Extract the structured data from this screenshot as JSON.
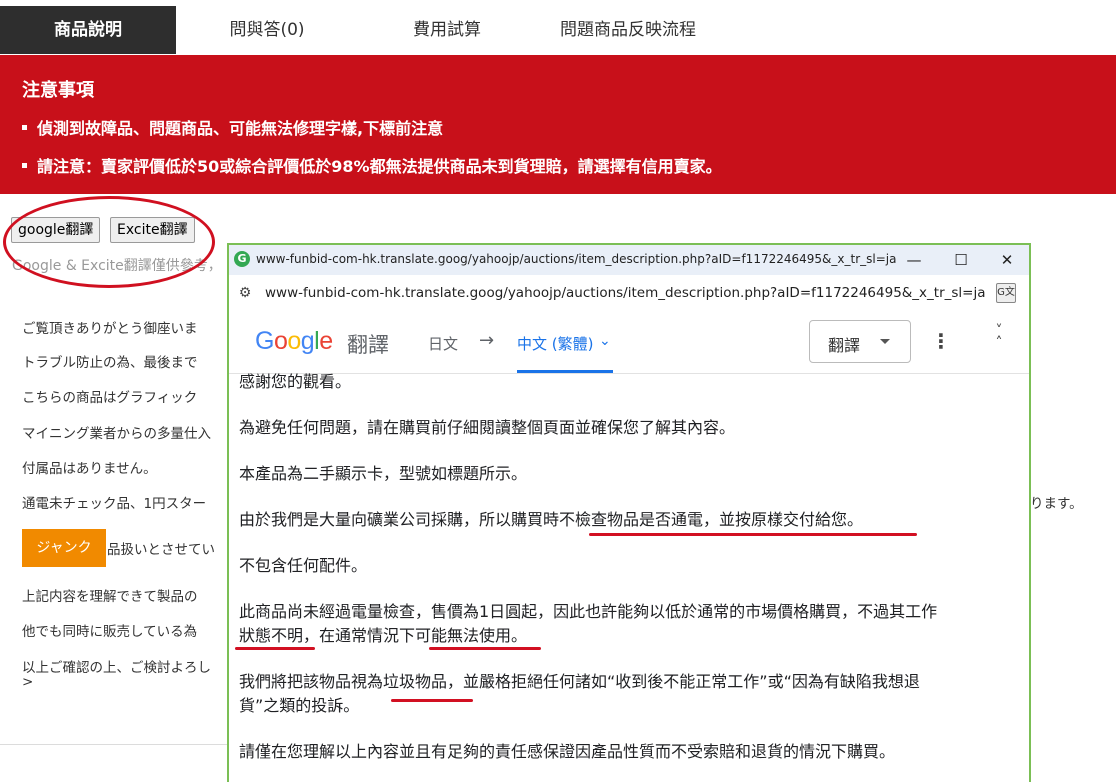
{
  "tabs": [
    {
      "label": "商品說明",
      "active": true
    },
    {
      "label": "問與答(0)",
      "active": false
    },
    {
      "label": "費用試算",
      "active": false
    },
    {
      "label": "問題商品反映流程",
      "active": false
    }
  ],
  "notice": {
    "title": "注意事項",
    "items": [
      "偵測到故障品、問題商品、可能無法修理字樣,下標前注意",
      "請注意：賣家評價低於50或綜合評價低於98%都無法提供商品未到貨理賠，請選擇有信用賣家。"
    ]
  },
  "translate_buttons": {
    "google": "google翻譯",
    "excite": "Excite翻譯"
  },
  "translate_note": "Google & Excite翻譯僅供參考，",
  "background_lines": [
    "ご覧頂きありがとう御座いま",
    "トラブル防止の為、最後まで",
    "こちらの商品はグラフィック",
    "マイニング業者からの多量仕入",
    "付属品はありません。",
    "通電未チェック品、1円スター",
    "品扱いとさせてい",
    "上記内容を理解できて製品の",
    "他でも同時に販売している為",
    "以上ご確認の上、ご検討よろし",
    ">"
  ],
  "background_right_text": "ります。",
  "junk_badge": "ジャンク",
  "popup": {
    "window_title": "www-funbid-com-hk.translate.goog/yahoojp/auctions/item_description.php?aID=f1172246495&_x_tr_sl=ja&_x_tr_tl=z...",
    "url": "www-funbid-com-hk.translate.goog/yahoojp/auctions/item_description.php?aID=f1172246495&_x_tr_sl=ja&_x_tr_...",
    "google_logo": "Google",
    "product_name": "翻譯",
    "source_lang": "日文",
    "arrow": "→",
    "target_lang": "中文 (繁體)",
    "translate_button": "翻譯",
    "translated_lines": [
      "感謝您的觀看。",
      "為避免任何問題，請在購買前仔細閱讀整個頁面並確保您了解其內容。",
      "本產品為二手顯示卡，型號如標題所示。",
      "由於我們是大量向礦業公司採購，所以購買時不檢查物品是否通電，並按原樣交付給您。",
      "不包含任何配件。",
      "此商品尚未經過電量檢查，售價為1日圓起，因此也許能夠以低於通常的市場價格購買，不過其工作",
      "狀態不明，在通常情況下可能無法使用。",
      "我們將把該物品視為垃圾物品，並嚴格拒絕任何諸如“收到後不能正常工作”或“因為有缺陷我想退",
      "貨”之類的投訴。",
      "請僅在您理解以上內容並且有足夠的責任感保證因產品性質而不受索賠和退貨的情況下購買。"
    ]
  },
  "colors": {
    "notice_red": "#c8101a",
    "active_tab": "#2e2e2e",
    "junk_orange": "#f18a00",
    "popup_border": "#7bbf55",
    "annotation_red": "#d01020"
  }
}
